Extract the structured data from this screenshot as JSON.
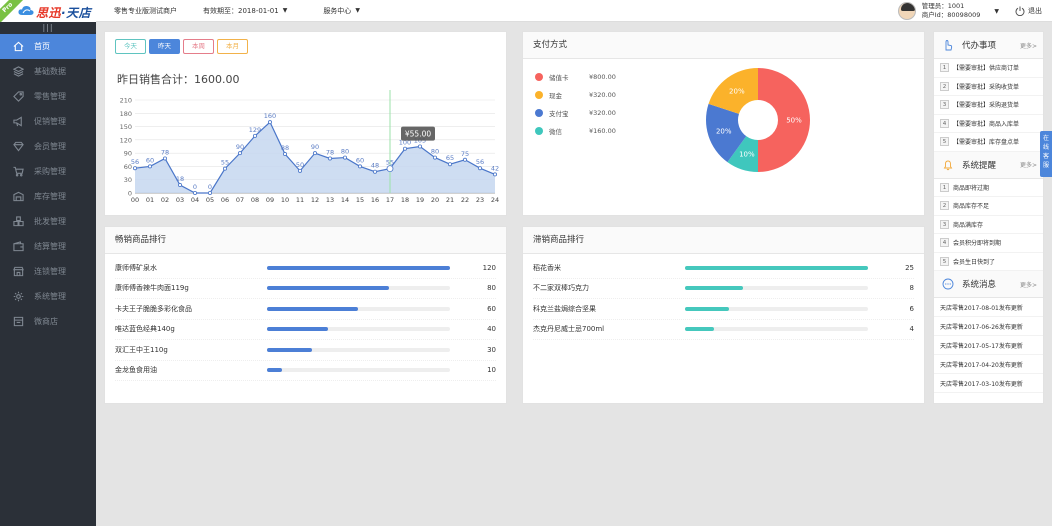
{
  "logo": {
    "badge": "Pro",
    "brand_a": "思迅",
    "brand_b": "天店"
  },
  "header": {
    "store_name": "零售专业版测试商户",
    "valid_label": "有效期至：2018-01-01",
    "service_label": "服务中心",
    "admin_line": "管理员：1001",
    "merchant_line": "商户Id：80098009",
    "logout_label": "退出"
  },
  "sidebar": {
    "collapse": "|||",
    "items": [
      {
        "label": "首页",
        "icon": "home-icon"
      },
      {
        "label": "基础数据",
        "icon": "layers-icon"
      },
      {
        "label": "零售管理",
        "icon": "tag-icon"
      },
      {
        "label": "促销管理",
        "icon": "megaphone-icon"
      },
      {
        "label": "会员管理",
        "icon": "diamond-icon"
      },
      {
        "label": "采购管理",
        "icon": "cart-icon"
      },
      {
        "label": "库存管理",
        "icon": "warehouse-icon"
      },
      {
        "label": "批发管理",
        "icon": "boxes-icon"
      },
      {
        "label": "结算管理",
        "icon": "wallet-icon"
      },
      {
        "label": "连锁管理",
        "icon": "store-icon"
      },
      {
        "label": "系统管理",
        "icon": "gear-icon"
      },
      {
        "label": "微商店",
        "icon": "mobile-shop-icon"
      }
    ]
  },
  "sales": {
    "tabs": [
      "今天",
      "昨天",
      "本周",
      "本月"
    ],
    "total_label": "昨日销售合计：1600.00",
    "tooltip": "¥55.00"
  },
  "chart_data": [
    {
      "type": "area",
      "x": [
        "00",
        "01",
        "02",
        "03",
        "04",
        "05",
        "06",
        "07",
        "08",
        "09",
        "10",
        "11",
        "12",
        "13",
        "14",
        "15",
        "16",
        "17",
        "18",
        "19",
        "20",
        "21",
        "22",
        "23",
        "24"
      ],
      "series": [
        {
          "values": [
            56,
            60,
            78,
            18,
            0,
            0,
            55,
            90,
            129,
            160,
            88,
            50,
            90,
            78,
            80,
            60,
            48,
            55,
            100,
            105,
            80,
            65,
            75,
            56,
            42
          ]
        }
      ],
      "ylim": [
        0,
        210
      ],
      "yticks": [
        0,
        30,
        60,
        90,
        120,
        150,
        180,
        210
      ],
      "grid": true,
      "highlight_index": 17,
      "colors": {
        "line": "#4a76c9",
        "fill": "#c6d7f0",
        "highlight": "#9be2a8"
      }
    },
    {
      "type": "pie",
      "categories": [
        "储值卡",
        "现金",
        "支付宝",
        "微信"
      ],
      "values": [
        800,
        320,
        320,
        160
      ],
      "value_labels": [
        "¥800.00",
        "¥320.00",
        "¥320.00",
        "¥160.00"
      ],
      "percent_labels": [
        "50%",
        "20%",
        "20%",
        "10%"
      ],
      "colors": [
        "#f6635e",
        "#fbb22b",
        "#4b79d1",
        "#3fc7bd"
      ]
    }
  ],
  "payment": {
    "title": "支付方式"
  },
  "hot": {
    "title": "畅销商品排行",
    "max": 120,
    "rows": [
      {
        "name": "康师傅矿泉水",
        "value": 120
      },
      {
        "name": "康师傅香辣牛肉面119g",
        "value": 80
      },
      {
        "name": "卡夫王子脆脆多彩化食品",
        "value": 60
      },
      {
        "name": "唯达蓝色经典140g",
        "value": 40
      },
      {
        "name": "双汇王中王110g",
        "value": 30
      },
      {
        "name": "金龙鱼食用油",
        "value": 10
      }
    ]
  },
  "slow": {
    "title": "滞销商品排行",
    "max": 25,
    "rows": [
      {
        "name": "稻花香米",
        "value": 25
      },
      {
        "name": "不二家双棒巧克力",
        "value": 8
      },
      {
        "name": "科克兰盐焗综合坚果",
        "value": 6
      },
      {
        "name": "杰克丹尼威士忌700ml",
        "value": 4
      }
    ]
  },
  "todo": {
    "title": "代办事项",
    "more": "更多>",
    "items": [
      "【需要审批】供应商订单",
      "【需要审批】采购收货单",
      "【需要审批】采购退货单",
      "【需要审批】商品入库单",
      "【需要审批】库存盘点单"
    ]
  },
  "alerts": {
    "title": "系统提醒",
    "more": "更多>",
    "items": [
      "商品即将过期",
      "商品库存不足",
      "商品满库存",
      "会员积分即将到期",
      "会员生日快到了"
    ]
  },
  "messages": {
    "title": "系统消息",
    "more": "更多>",
    "items": [
      "天店零售2017-08-01发布更新",
      "天店零售2017-06-26发布更新",
      "天店零售2017-05-17发布更新",
      "天店零售2017-04-20发布更新",
      "天店零售2017-03-10发布更新"
    ]
  },
  "online_service": "在线客服"
}
